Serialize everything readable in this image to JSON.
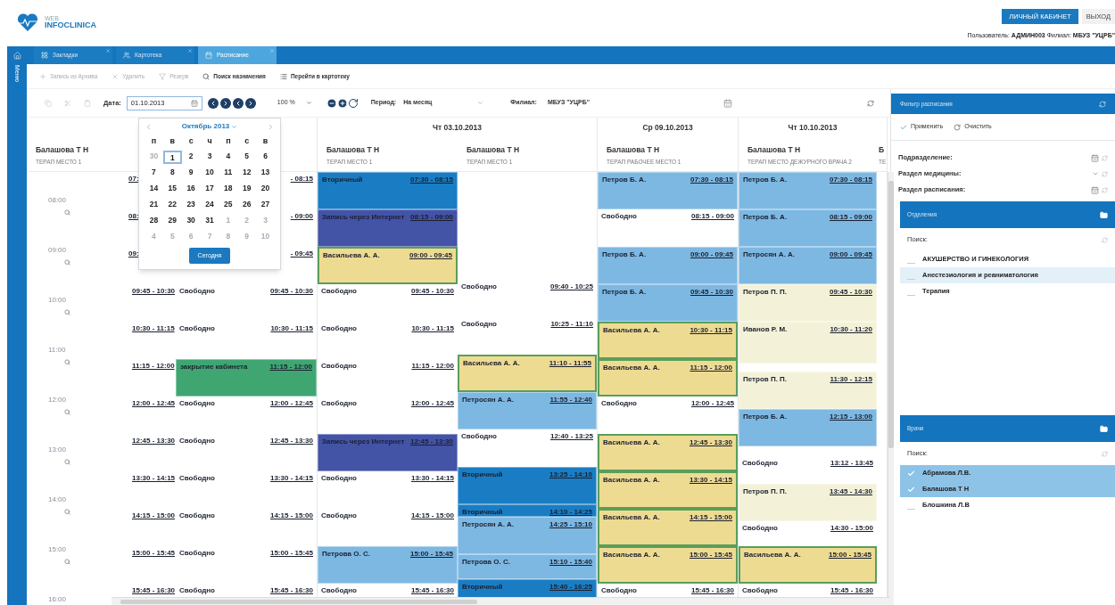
{
  "header": {
    "logo_small": "WEB",
    "logo": "INFOCLINICA",
    "cabinet_button": "ЛИЧНЫЙ КАБИНЕТ",
    "logout_button": "ВЫХОД",
    "user_line": "Пользователь: **АДМИН003** Филиал: **МБУЗ \"УЦРБ\"**"
  },
  "sidebar": {
    "label": "Меню"
  },
  "tabs": [
    {
      "label": "Закладки",
      "selected": false
    },
    {
      "label": "Картотека",
      "selected": false
    },
    {
      "label": "Расписание",
      "selected": true
    }
  ],
  "actions": [
    {
      "label": "Запись из Архива",
      "disabled": true
    },
    {
      "label": "Удалить",
      "disabled": true
    },
    {
      "label": "Резерв",
      "disabled": true
    },
    {
      "label": "Поиск назначения",
      "disabled": false
    },
    {
      "label": "Перейти в картотеку",
      "disabled": false
    }
  ],
  "toolbar": {
    "date_label": "Дата:",
    "date_value": "01.10.2013",
    "zoom": "100 %",
    "period_label": "Период:",
    "period_value": "На месяц",
    "branch_label": "Филиал:",
    "branch_value": "МБУЗ \"УЦРБ\""
  },
  "date_picker": {
    "month": "Октябрь 2013",
    "weekdays": [
      "п",
      "в",
      "с",
      "ч",
      "п",
      "с",
      "в"
    ],
    "today_button": "Сегодня",
    "days": [
      {
        "day": "30",
        "outside": true,
        "selected": false
      },
      {
        "day": "1",
        "outside": false,
        "selected": true
      },
      {
        "day": "2",
        "outside": false,
        "selected": false
      },
      {
        "day": "3",
        "outside": false,
        "selected": false
      },
      {
        "day": "4",
        "outside": false,
        "selected": false
      },
      {
        "day": "5",
        "outside": false,
        "selected": false
      },
      {
        "day": "6",
        "outside": false,
        "selected": false
      },
      {
        "day": "7",
        "outside": false,
        "selected": false
      },
      {
        "day": "8",
        "outside": false,
        "selected": false
      },
      {
        "day": "9",
        "outside": false,
        "selected": false
      },
      {
        "day": "10",
        "outside": false,
        "selected": false
      },
      {
        "day": "11",
        "outside": false,
        "selected": false
      },
      {
        "day": "12",
        "outside": false,
        "selected": false
      },
      {
        "day": "13",
        "outside": false,
        "selected": false
      },
      {
        "day": "14",
        "outside": false,
        "selected": false
      },
      {
        "day": "15",
        "outside": false,
        "selected": false
      },
      {
        "day": "16",
        "outside": false,
        "selected": false
      },
      {
        "day": "17",
        "outside": false,
        "selected": false
      },
      {
        "day": "18",
        "outside": false,
        "selected": false
      },
      {
        "day": "19",
        "outside": false,
        "selected": false
      },
      {
        "day": "20",
        "outside": false,
        "selected": false
      },
      {
        "day": "21",
        "outside": false,
        "selected": false
      },
      {
        "day": "22",
        "outside": false,
        "selected": false
      },
      {
        "day": "23",
        "outside": false,
        "selected": false
      },
      {
        "day": "24",
        "outside": false,
        "selected": false
      },
      {
        "day": "25",
        "outside": false,
        "selected": false
      },
      {
        "day": "26",
        "outside": false,
        "selected": false
      },
      {
        "day": "27",
        "outside": false,
        "selected": false
      },
      {
        "day": "28",
        "outside": false,
        "selected": false
      },
      {
        "day": "29",
        "outside": false,
        "selected": false
      },
      {
        "day": "30",
        "outside": false,
        "selected": false
      },
      {
        "day": "31",
        "outside": false,
        "selected": false
      },
      {
        "day": "1",
        "outside": true,
        "selected": false
      },
      {
        "day": "2",
        "outside": true,
        "selected": false
      },
      {
        "day": "3",
        "outside": true,
        "selected": false
      },
      {
        "day": "4",
        "outside": true,
        "selected": false
      },
      {
        "day": "5",
        "outside": true,
        "selected": false
      },
      {
        "day": "6",
        "outside": true,
        "selected": false
      },
      {
        "day": "7",
        "outside": true,
        "selected": false
      },
      {
        "day": "8",
        "outside": true,
        "selected": false
      },
      {
        "day": "9",
        "outside": true,
        "selected": false
      },
      {
        "day": "10",
        "outside": true,
        "selected": false
      }
    ]
  },
  "time_axis": [
    "08:00",
    "09:00",
    "10:00",
    "11:00",
    "12:00",
    "13:00",
    "14:00",
    "15:00",
    "16:00"
  ],
  "days": [
    {
      "columns": [
        {
          "doctor": "Балашова Т Н",
          "place": "ТЕРАП МЕСТО 1",
          "slots": [
            {
              "time": "07:",
              "kind": "partial_left"
            },
            {
              "time": "08:",
              "kind": "partial_left"
            },
            {
              "time": "09:",
              "kind": "partial_left"
            },
            {
              "time": "09:45 - 10:30",
              "kind": "free"
            },
            {
              "time": "10:30 - 11:15",
              "kind": "free"
            },
            {
              "time": "11:15 - 12:00",
              "kind": "free"
            },
            {
              "time": "12:00 - 12:45",
              "kind": "free"
            },
            {
              "time": "12:45 - 13:30",
              "kind": "free"
            },
            {
              "time": "13:30 - 14:15",
              "kind": "free"
            },
            {
              "time": "14:15 - 15:00",
              "kind": "free"
            },
            {
              "time": "15:00 - 15:45",
              "kind": "free"
            },
            {
              "time": "15:45 - 16:30",
              "kind": "free"
            }
          ]
        },
        {
          "slots": [
            {
              "time": "- 08:15",
              "kind": "partial_right"
            },
            {
              "time": "- 09:00",
              "kind": "partial_right"
            },
            {
              "time": "- 09:45",
              "kind": "partial_right"
            },
            {
              "time": "09:45 - 10:30",
              "label": "Свободно",
              "kind": "free"
            },
            {
              "time": "10:30 - 11:15",
              "label": "Свободно",
              "kind": "free"
            },
            {
              "time": "11:15 - 12:00",
              "label": "закрытие кабинета",
              "kind": "booked",
              "color": "#3fa672",
              "outlined": false
            },
            {
              "time": "12:00 - 12:45",
              "label": "Свободно",
              "kind": "free"
            },
            {
              "time": "12:45 - 13:30",
              "label": "Свободно",
              "kind": "free"
            },
            {
              "time": "13:30 - 14:15",
              "label": "Свободно",
              "kind": "free"
            },
            {
              "time": "14:15 - 15:00",
              "label": "Свободно",
              "kind": "free"
            },
            {
              "time": "15:00 - 15:45",
              "label": "Свободно",
              "kind": "free"
            },
            {
              "time": "15:45 - 16:30",
              "label": "Свободно",
              "kind": "free"
            }
          ]
        }
      ]
    },
    {
      "date": "Чт 03.10.2013",
      "columns": [
        {
          "doctor": "Балашова Т Н",
          "place": "ТЕРАП МЕСТО 1",
          "slots": [
            {
              "time": "07:30 - 08:15",
              "label": "Вторичный",
              "kind": "booked",
              "color": "#1a7dc4",
              "outlined": false
            },
            {
              "time": "08:15 - 09:00",
              "label": "Запись через Интернет",
              "kind": "booked",
              "color": "#4353a6",
              "outlined": false
            },
            {
              "time": "09:00 - 09:45",
              "label": "Васильева А. А.",
              "kind": "booked",
              "color": "#eedb92",
              "outlined": true
            },
            {
              "time": "09:45 - 10:30",
              "label": "Свободно",
              "kind": "free"
            },
            {
              "time": "10:30 - 11:15",
              "label": "Свободно",
              "kind": "free"
            },
            {
              "time": "11:15 - 12:00",
              "label": "Свободно",
              "kind": "free"
            },
            {
              "time": "12:00 - 12:45",
              "label": "Свободно",
              "kind": "free"
            },
            {
              "time": "12:45 - 13:30",
              "label": "Запись через Интернет",
              "kind": "booked",
              "color": "#4353a6",
              "outlined": false
            },
            {
              "time": "13:30 - 14:15",
              "label": "Свободно",
              "kind": "free"
            },
            {
              "time": "14:15 - 15:00",
              "label": "Свободно",
              "kind": "free"
            },
            {
              "time": "15:00 - 15:45",
              "label": "Петрова О. С.",
              "kind": "booked",
              "color": "#7db8e2",
              "outlined": false
            },
            {
              "time": "15:45 - 16:30",
              "label": "Свободно",
              "kind": "free"
            }
          ]
        },
        {
          "doctor": "Балашова Т Н",
          "place": "ТЕРАП МЕСТО 1",
          "slots": [
            {
              "time": "09:40 - 10:25",
              "label": "Свободно",
              "kind": "free"
            },
            {
              "time": "10:25 - 11:10",
              "label": "Свободно",
              "kind": "free"
            },
            {
              "time": "11:10 - 11:55",
              "label": "Васильева А. А.",
              "kind": "booked",
              "color": "#eedb92",
              "outlined": true
            },
            {
              "time": "11:55 - 12:40",
              "label": "Петросян А. А.",
              "kind": "booked",
              "color": "#7db8e2",
              "outlined": false
            },
            {
              "time": "12:40 - 13:25",
              "label": "Свободно",
              "kind": "free"
            },
            {
              "time": "13:25 - 14:10",
              "label": "Вторичный",
              "kind": "booked",
              "color": "#1a7dc4",
              "outlined": false
            },
            {
              "time": "14:10 - 14:25",
              "label": "Вторичный",
              "kind": "booked",
              "color": "#1a7dc4",
              "outlined": false
            },
            {
              "time": "14:25 - 15:10",
              "label": "Петросян А. А.",
              "kind": "booked",
              "color": "#7db8e2",
              "outlined": false
            },
            {
              "time": "15:10 - 15:40",
              "label": "Петрова О. С.",
              "kind": "booked",
              "color": "#7db8e2",
              "outlined": false
            },
            {
              "time": "15:40 - 16:25",
              "label": "Вторичный",
              "kind": "booked",
              "color": "#1a7dc4",
              "outlined": false
            }
          ]
        }
      ]
    },
    {
      "date": "Ср 09.10.2013",
      "columns": [
        {
          "doctor": "Балашова Т Н",
          "place": "ТЕРАП РАБОЧЕЕ МЕСТО 1",
          "slots": [
            {
              "time": "07:30 - 08:15",
              "label": "Петров Б. А.",
              "kind": "booked",
              "color": "#7db8e2",
              "outlined": false
            },
            {
              "time": "08:15 - 09:00",
              "label": "Свободно",
              "kind": "free"
            },
            {
              "time": "09:00 - 09:45",
              "label": "Петров Б. А.",
              "kind": "booked",
              "color": "#7db8e2",
              "outlined": false
            },
            {
              "time": "09:45 - 10:30",
              "label": "Петров Б. А.",
              "kind": "booked",
              "color": "#7db8e2",
              "outlined": false
            },
            {
              "time": "10:30 - 11:15",
              "label": "Васильева А. А.",
              "kind": "booked",
              "color": "#eedb92",
              "outlined": true
            },
            {
              "time": "11:15 - 12:00",
              "label": "Васильева А. А.",
              "kind": "booked",
              "color": "#eedb92",
              "outlined": true
            },
            {
              "time": "12:00 - 12:45",
              "label": "Свободно",
              "kind": "free"
            },
            {
              "time": "12:45 - 13:30",
              "label": "Васильева А. А.",
              "kind": "booked",
              "color": "#eedb92",
              "outlined": true
            },
            {
              "time": "13:30 - 14:15",
              "label": "Васильева А. А.",
              "kind": "booked",
              "color": "#eedb92",
              "outlined": true
            },
            {
              "time": "14:15 - 15:00",
              "label": "Васильева А. А.",
              "kind": "booked",
              "color": "#eedb92",
              "outlined": true
            },
            {
              "time": "15:00 - 15:45",
              "label": "Васильева А. А.",
              "kind": "booked",
              "color": "#eedb92",
              "outlined": true
            },
            {
              "time": "15:45 - 16:30",
              "label": "Свободно",
              "kind": "free"
            }
          ]
        }
      ]
    },
    {
      "date": "Чт 10.10.2013",
      "columns": [
        {
          "doctor": "Балашова Т Н",
          "place": "ТЕРАП МЕСТО ДЕЖУРНОГО ВРАЧА 2",
          "slots": [
            {
              "time": "07:30 - 08:15",
              "label": "Петров Б. А.",
              "kind": "booked",
              "color": "#7db8e2",
              "outlined": false
            },
            {
              "time": "08:15 - 09:00",
              "label": "Петров Б. А.",
              "kind": "booked",
              "color": "#7db8e2",
              "outlined": false
            },
            {
              "time": "09:00 - 09:45",
              "label": "Петросян А. А.",
              "kind": "booked",
              "color": "#7db8e2",
              "outlined": false
            },
            {
              "time": "09:45 - 10:30",
              "label": "Петров П. П.",
              "kind": "booked",
              "color": "#f3f2d8",
              "outlined": false
            },
            {
              "time": "10:30 - 11:20",
              "label": "Иванов Р. М.",
              "kind": "booked",
              "color": "#f3f2d8",
              "outlined": false
            },
            {
              "time": "11:30 - 12:15",
              "label": "Петров П. П.",
              "kind": "booked",
              "color": "#f3f2d8",
              "outlined": false
            },
            {
              "time": "12:15 - 13:00",
              "label": "Петров Б. А.",
              "kind": "booked",
              "color": "#7db8e2",
              "outlined": false
            },
            {
              "time": "13:12 - 13:45",
              "label": "Свободно",
              "kind": "free"
            },
            {
              "time": "13:45 - 14:30",
              "label": "Петров П. П.",
              "kind": "booked",
              "color": "#f3f2d8",
              "outlined": false
            },
            {
              "time": "14:30 - 15:00",
              "label": "Свободно",
              "kind": "free"
            },
            {
              "time": "15:00 - 15:45",
              "label": "Васильева А. А.",
              "kind": "booked",
              "color": "#eedb92",
              "outlined": true
            },
            {
              "time": "15:45 - 16:30",
              "label": "Свободно",
              "kind": "free"
            }
          ]
        },
        {
          "doctor": "Б",
          "place": "ТЕ"
        }
      ]
    }
  ],
  "filter": {
    "title": "Фильтр расписания",
    "apply": "Применить",
    "clear": "Очистить",
    "fields": [
      {
        "label": "Подразделение:",
        "kind": "picker"
      },
      {
        "label": "Раздел медицины:",
        "kind": "select"
      },
      {
        "label": "Раздел расписания:",
        "kind": "picker"
      }
    ],
    "sections": [
      {
        "title": "Отделения",
        "search_label": "Поиск:",
        "items": [
          {
            "label": "АКУШЕРСТВО И ГИНЕКОЛОГИЯ",
            "checked": false,
            "selected": false
          },
          {
            "label": "Анестезиология и реаниматология",
            "checked": false,
            "selected": true
          },
          {
            "label": "Терапия",
            "checked": false,
            "selected": false
          }
        ]
      },
      {
        "title": "Врачи",
        "search_label": "Поиск:",
        "items": [
          {
            "label": "Абрамова Л.В.",
            "checked": true,
            "selected": true
          },
          {
            "label": "Балашова Т Н",
            "checked": true,
            "selected": true
          },
          {
            "label": "Блошкина Л.В",
            "checked": false,
            "selected": false
          }
        ]
      }
    ]
  }
}
